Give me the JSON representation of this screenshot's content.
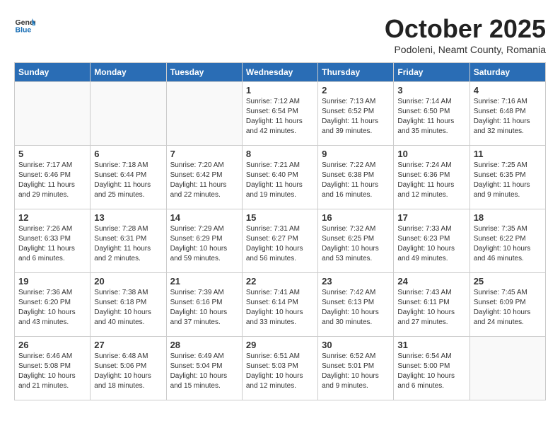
{
  "header": {
    "logo_general": "General",
    "logo_blue": "Blue",
    "month": "October 2025",
    "location": "Podoleni, Neamt County, Romania"
  },
  "weekdays": [
    "Sunday",
    "Monday",
    "Tuesday",
    "Wednesday",
    "Thursday",
    "Friday",
    "Saturday"
  ],
  "weeks": [
    [
      {
        "day": "",
        "info": ""
      },
      {
        "day": "",
        "info": ""
      },
      {
        "day": "",
        "info": ""
      },
      {
        "day": "1",
        "info": "Sunrise: 7:12 AM\nSunset: 6:54 PM\nDaylight: 11 hours\nand 42 minutes."
      },
      {
        "day": "2",
        "info": "Sunrise: 7:13 AM\nSunset: 6:52 PM\nDaylight: 11 hours\nand 39 minutes."
      },
      {
        "day": "3",
        "info": "Sunrise: 7:14 AM\nSunset: 6:50 PM\nDaylight: 11 hours\nand 35 minutes."
      },
      {
        "day": "4",
        "info": "Sunrise: 7:16 AM\nSunset: 6:48 PM\nDaylight: 11 hours\nand 32 minutes."
      }
    ],
    [
      {
        "day": "5",
        "info": "Sunrise: 7:17 AM\nSunset: 6:46 PM\nDaylight: 11 hours\nand 29 minutes."
      },
      {
        "day": "6",
        "info": "Sunrise: 7:18 AM\nSunset: 6:44 PM\nDaylight: 11 hours\nand 25 minutes."
      },
      {
        "day": "7",
        "info": "Sunrise: 7:20 AM\nSunset: 6:42 PM\nDaylight: 11 hours\nand 22 minutes."
      },
      {
        "day": "8",
        "info": "Sunrise: 7:21 AM\nSunset: 6:40 PM\nDaylight: 11 hours\nand 19 minutes."
      },
      {
        "day": "9",
        "info": "Sunrise: 7:22 AM\nSunset: 6:38 PM\nDaylight: 11 hours\nand 16 minutes."
      },
      {
        "day": "10",
        "info": "Sunrise: 7:24 AM\nSunset: 6:36 PM\nDaylight: 11 hours\nand 12 minutes."
      },
      {
        "day": "11",
        "info": "Sunrise: 7:25 AM\nSunset: 6:35 PM\nDaylight: 11 hours\nand 9 minutes."
      }
    ],
    [
      {
        "day": "12",
        "info": "Sunrise: 7:26 AM\nSunset: 6:33 PM\nDaylight: 11 hours\nand 6 minutes."
      },
      {
        "day": "13",
        "info": "Sunrise: 7:28 AM\nSunset: 6:31 PM\nDaylight: 11 hours\nand 2 minutes."
      },
      {
        "day": "14",
        "info": "Sunrise: 7:29 AM\nSunset: 6:29 PM\nDaylight: 10 hours\nand 59 minutes."
      },
      {
        "day": "15",
        "info": "Sunrise: 7:31 AM\nSunset: 6:27 PM\nDaylight: 10 hours\nand 56 minutes."
      },
      {
        "day": "16",
        "info": "Sunrise: 7:32 AM\nSunset: 6:25 PM\nDaylight: 10 hours\nand 53 minutes."
      },
      {
        "day": "17",
        "info": "Sunrise: 7:33 AM\nSunset: 6:23 PM\nDaylight: 10 hours\nand 49 minutes."
      },
      {
        "day": "18",
        "info": "Sunrise: 7:35 AM\nSunset: 6:22 PM\nDaylight: 10 hours\nand 46 minutes."
      }
    ],
    [
      {
        "day": "19",
        "info": "Sunrise: 7:36 AM\nSunset: 6:20 PM\nDaylight: 10 hours\nand 43 minutes."
      },
      {
        "day": "20",
        "info": "Sunrise: 7:38 AM\nSunset: 6:18 PM\nDaylight: 10 hours\nand 40 minutes."
      },
      {
        "day": "21",
        "info": "Sunrise: 7:39 AM\nSunset: 6:16 PM\nDaylight: 10 hours\nand 37 minutes."
      },
      {
        "day": "22",
        "info": "Sunrise: 7:41 AM\nSunset: 6:14 PM\nDaylight: 10 hours\nand 33 minutes."
      },
      {
        "day": "23",
        "info": "Sunrise: 7:42 AM\nSunset: 6:13 PM\nDaylight: 10 hours\nand 30 minutes."
      },
      {
        "day": "24",
        "info": "Sunrise: 7:43 AM\nSunset: 6:11 PM\nDaylight: 10 hours\nand 27 minutes."
      },
      {
        "day": "25",
        "info": "Sunrise: 7:45 AM\nSunset: 6:09 PM\nDaylight: 10 hours\nand 24 minutes."
      }
    ],
    [
      {
        "day": "26",
        "info": "Sunrise: 6:46 AM\nSunset: 5:08 PM\nDaylight: 10 hours\nand 21 minutes."
      },
      {
        "day": "27",
        "info": "Sunrise: 6:48 AM\nSunset: 5:06 PM\nDaylight: 10 hours\nand 18 minutes."
      },
      {
        "day": "28",
        "info": "Sunrise: 6:49 AM\nSunset: 5:04 PM\nDaylight: 10 hours\nand 15 minutes."
      },
      {
        "day": "29",
        "info": "Sunrise: 6:51 AM\nSunset: 5:03 PM\nDaylight: 10 hours\nand 12 minutes."
      },
      {
        "day": "30",
        "info": "Sunrise: 6:52 AM\nSunset: 5:01 PM\nDaylight: 10 hours\nand 9 minutes."
      },
      {
        "day": "31",
        "info": "Sunrise: 6:54 AM\nSunset: 5:00 PM\nDaylight: 10 hours\nand 6 minutes."
      },
      {
        "day": "",
        "info": ""
      }
    ]
  ]
}
